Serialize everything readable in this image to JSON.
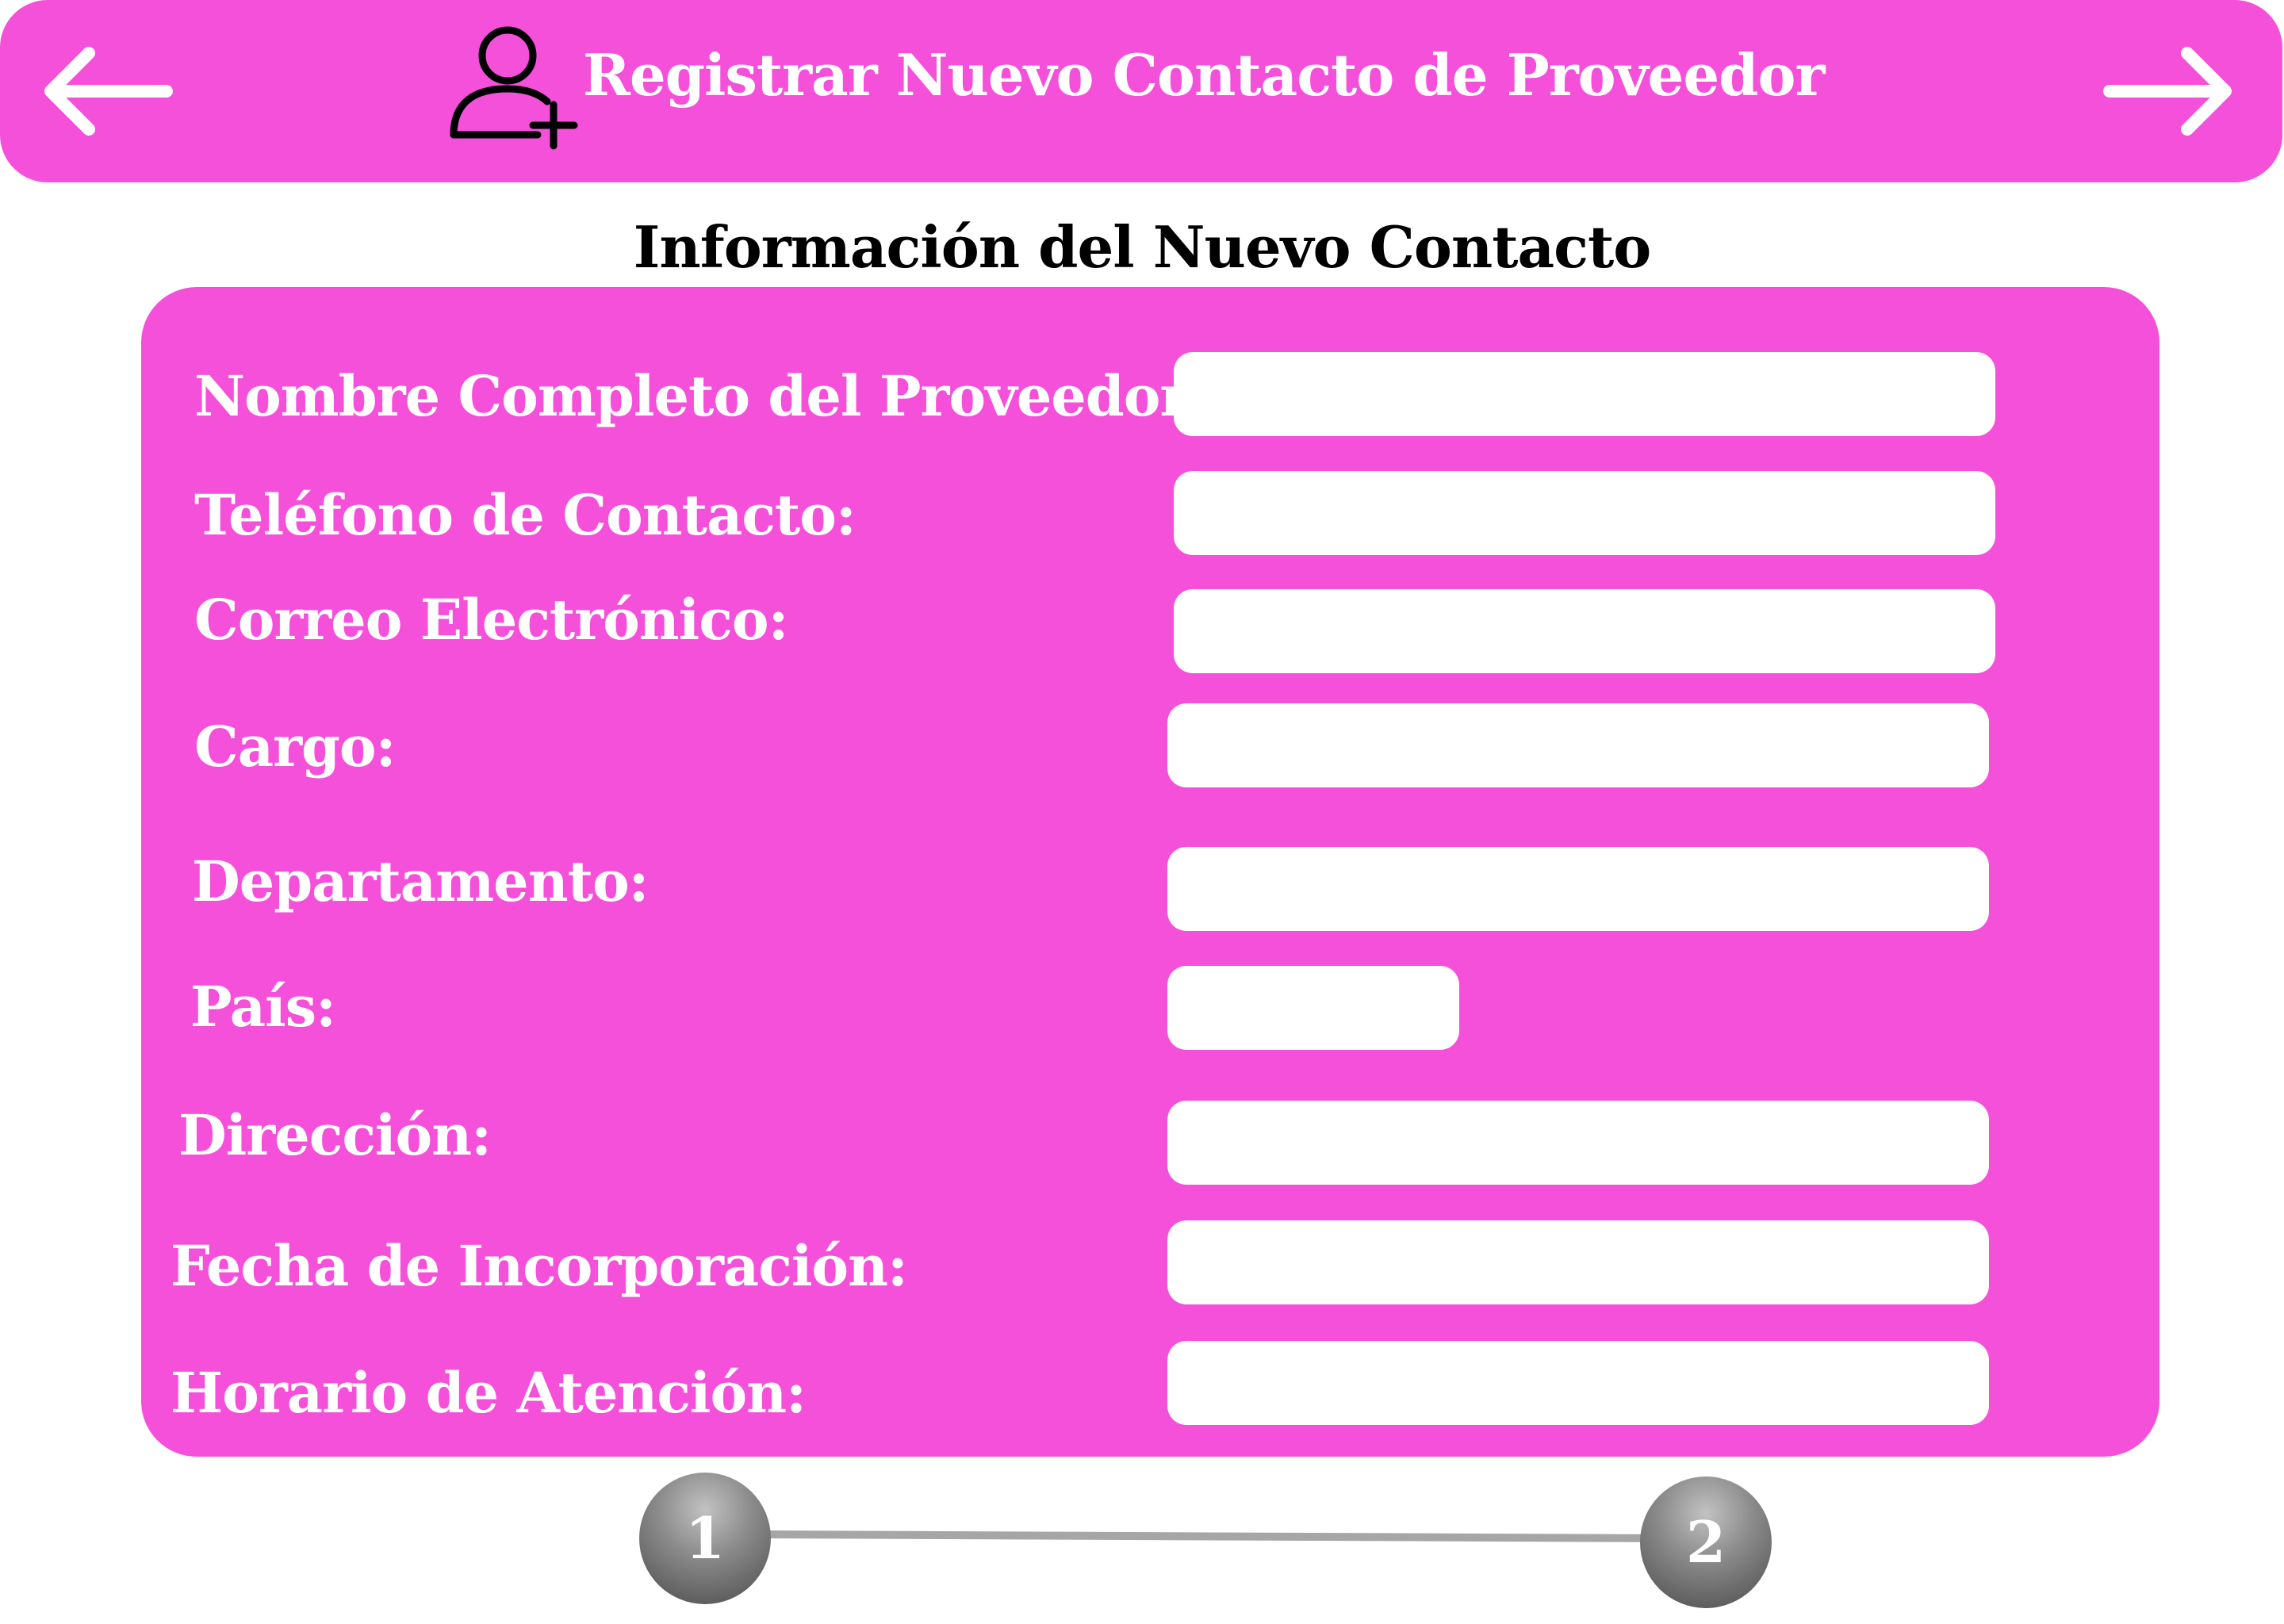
{
  "header": {
    "title": "Registrar Nuevo Contacto de Proveedor",
    "back_icon": "arrow-left-icon",
    "forward_icon": "arrow-right-icon",
    "title_icon": "user-plus-icon"
  },
  "section_title": "Información del Nuevo Contacto",
  "form": {
    "fields": [
      {
        "label": "Nombre Completo del Proveedor:",
        "value": ""
      },
      {
        "label": "Teléfono de Contacto:",
        "value": ""
      },
      {
        "label": "Correo Electrónico:",
        "value": ""
      },
      {
        "label": "Cargo:",
        "value": ""
      },
      {
        "label": "Departamento:",
        "value": ""
      },
      {
        "label": "País:",
        "value": ""
      },
      {
        "label": "Dirección:",
        "value": ""
      },
      {
        "label": "Fecha de Incorporación:",
        "value": ""
      },
      {
        "label": "Horario de Atención:",
        "value": ""
      }
    ]
  },
  "stepper": {
    "steps": [
      "1",
      "2"
    ]
  },
  "colors": {
    "accent": "#f550da",
    "input_background": "#ffffff",
    "step_circle": "#7a7a7a",
    "step_line": "#a6a6a6"
  }
}
